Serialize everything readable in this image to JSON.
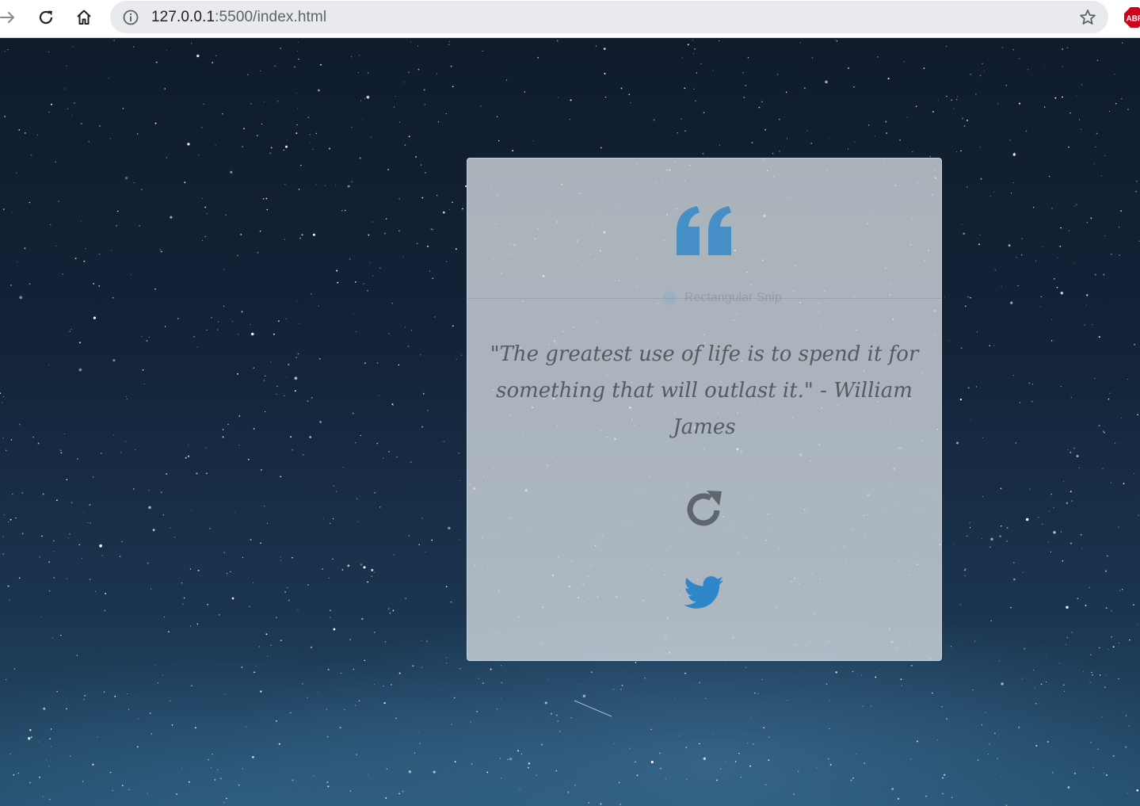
{
  "browser": {
    "url_host": "127.0.0.1",
    "url_rest": ":5500/index.html",
    "extension_badge": "ABP"
  },
  "icons": {
    "back": "arrow-right-icon",
    "reload": "reload-icon",
    "home": "home-icon",
    "info": "info-icon",
    "bookmark": "star-icon",
    "extension": "adblock-icon",
    "quote": "quote-left-icon",
    "new_quote": "refresh-icon",
    "share": "twitter-icon"
  },
  "colors": {
    "accent_blue": "#2f86c8",
    "icon_gray": "#5f676e",
    "card_bg": "rgba(214,220,226,0.78)",
    "text": "#555b61"
  },
  "card": {
    "quote": "\"The greatest use of life is to spend it for something that will outlast it.\" - William James",
    "snip_overlay_label": "Rectangular Snip"
  }
}
